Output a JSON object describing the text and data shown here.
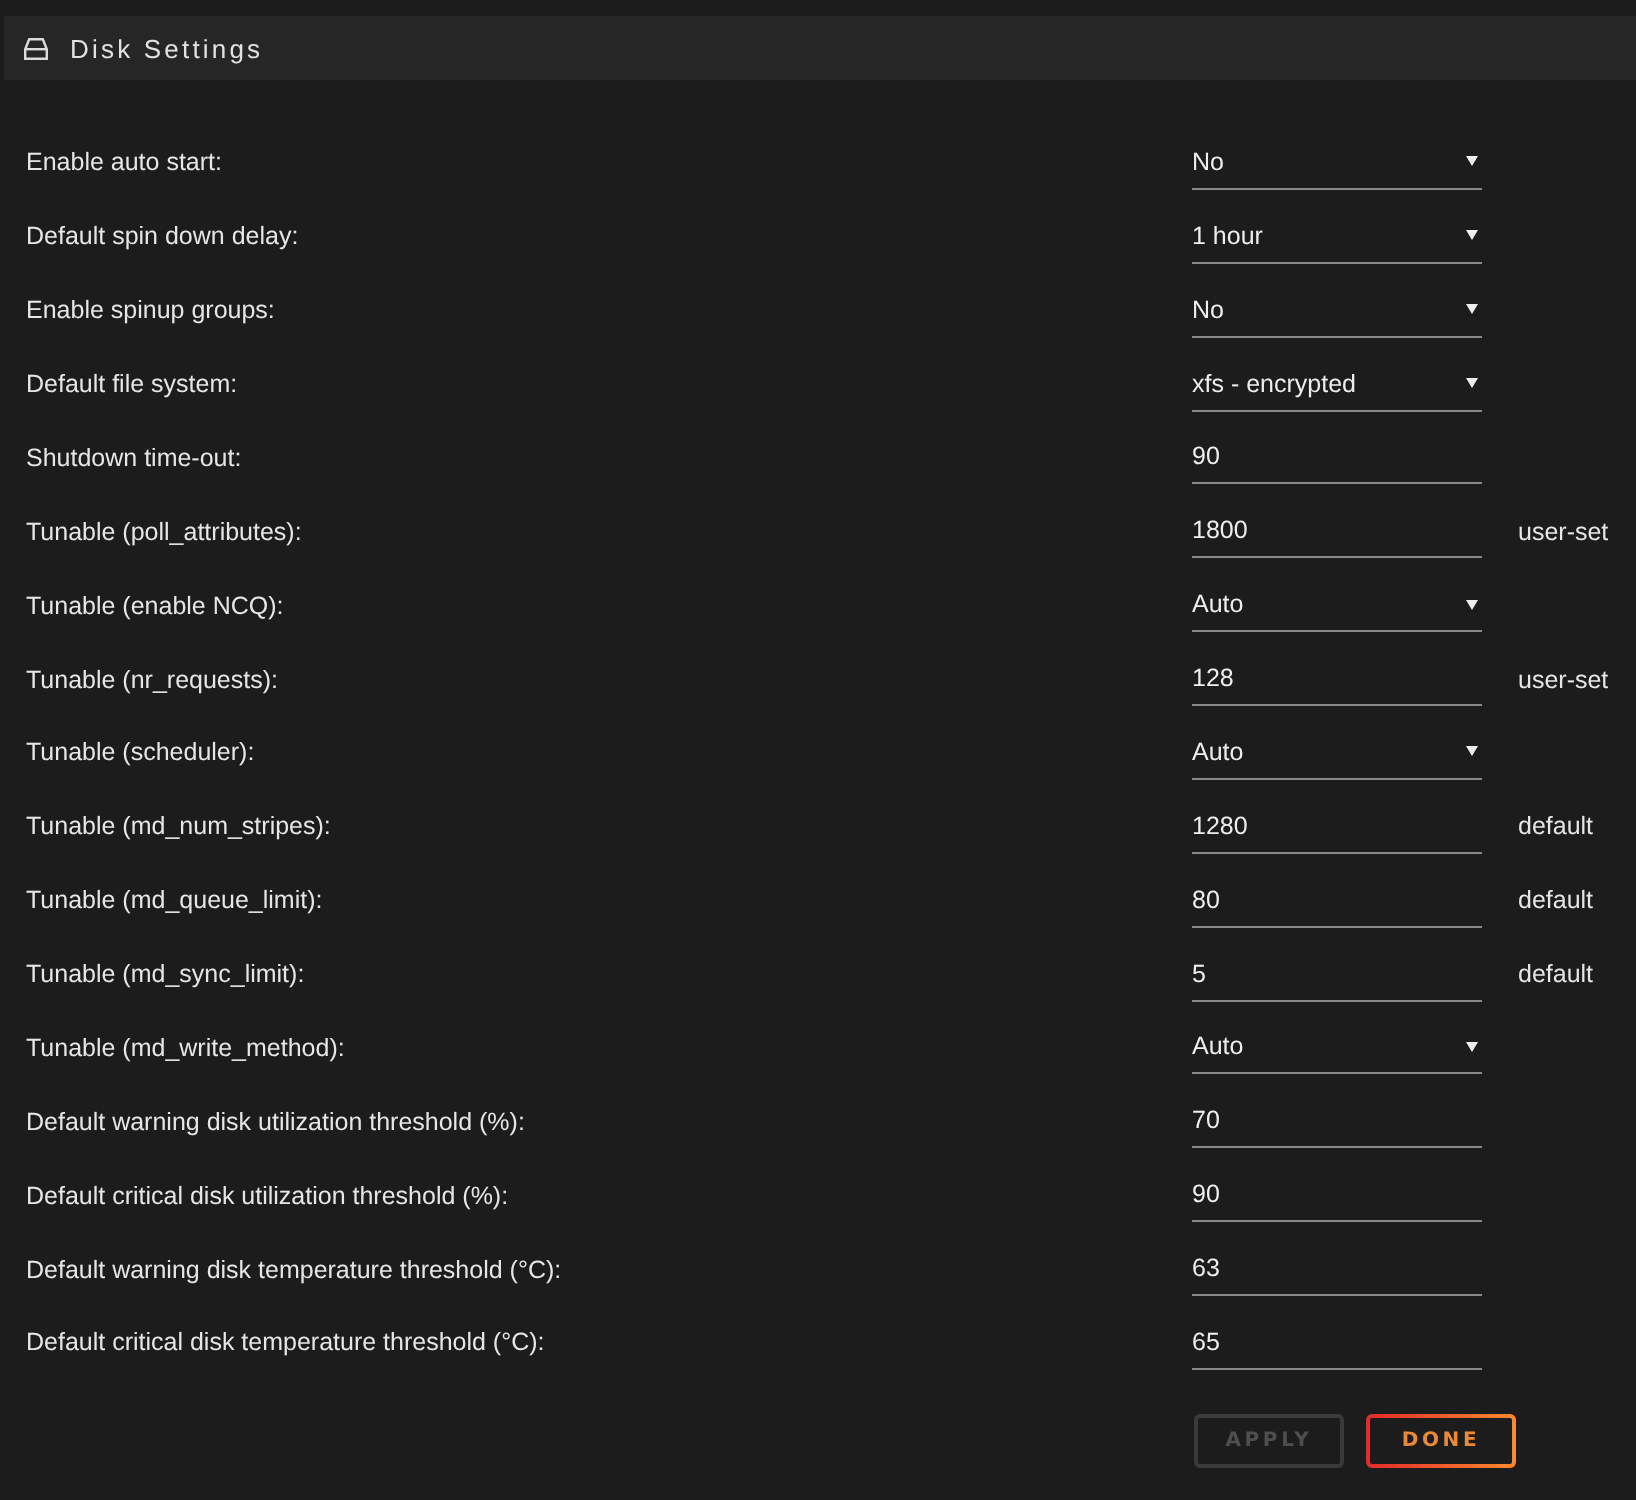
{
  "header": {
    "title": "Disk Settings"
  },
  "settings": [
    {
      "label": "Enable auto start:",
      "kind": "select",
      "value": "No"
    },
    {
      "label": "Default spin down delay:",
      "kind": "select",
      "value": "1 hour"
    },
    {
      "label": "Enable spinup groups:",
      "kind": "select",
      "value": "No"
    },
    {
      "label": "Default file system:",
      "kind": "select",
      "value": "xfs - encrypted"
    },
    {
      "label": "Shutdown time-out:",
      "kind": "input",
      "value": "90"
    },
    {
      "label": "Tunable (poll_attributes):",
      "kind": "input",
      "value": "1800",
      "note": "user-set"
    },
    {
      "label": "Tunable (enable NCQ):",
      "kind": "select",
      "value": "Auto"
    },
    {
      "label": "Tunable (nr_requests):",
      "kind": "input",
      "value": "128",
      "note": "user-set"
    },
    {
      "label": "Tunable (scheduler):",
      "kind": "select",
      "value": "Auto"
    },
    {
      "label": "Tunable (md_num_stripes):",
      "kind": "input",
      "value": "1280",
      "note": "default"
    },
    {
      "label": "Tunable (md_queue_limit):",
      "kind": "input",
      "value": "80",
      "note": "default"
    },
    {
      "label": "Tunable (md_sync_limit):",
      "kind": "input",
      "value": "5",
      "note": "default"
    },
    {
      "label": "Tunable (md_write_method):",
      "kind": "select",
      "value": "Auto"
    },
    {
      "label": "Default warning disk utilization threshold (%):",
      "kind": "input",
      "value": "70"
    },
    {
      "label": "Default critical disk utilization threshold (%):",
      "kind": "input",
      "value": "90"
    },
    {
      "label": "Default warning disk temperature threshold (°C):",
      "kind": "input",
      "value": "63"
    },
    {
      "label": "Default critical disk temperature threshold (°C):",
      "kind": "input",
      "value": "65"
    }
  ],
  "buttons": [
    {
      "label": "APPLY",
      "disabled": true
    },
    {
      "label": "DONE",
      "disabled": false
    }
  ]
}
